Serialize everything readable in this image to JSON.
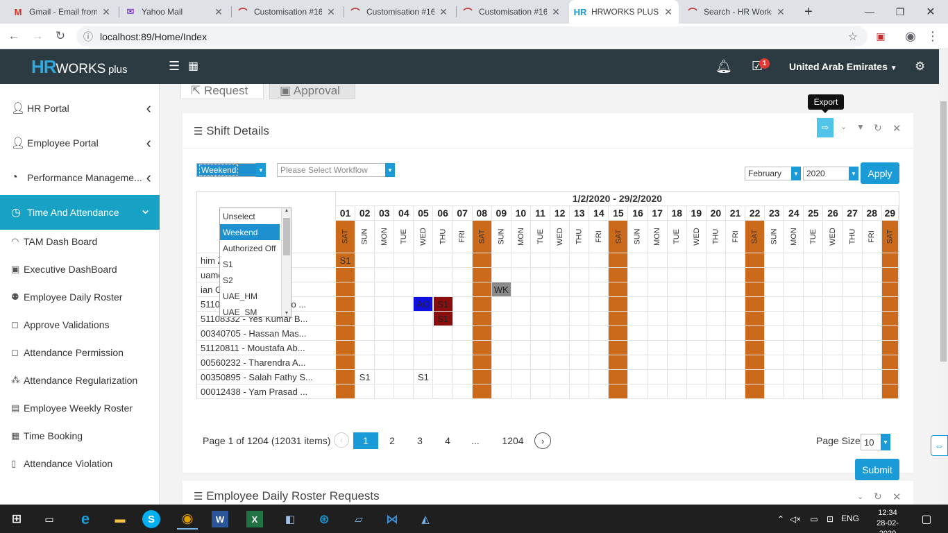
{
  "browser": {
    "tabs": [
      {
        "title": "Gmail - Email from",
        "fav": "M",
        "color": "#d93025"
      },
      {
        "title": "Yahoo Mail",
        "fav": "✉",
        "color": "#6001d2"
      },
      {
        "title": "Customisation #16",
        "fav": "⌒",
        "color": "#c62828"
      },
      {
        "title": "Customisation #16",
        "fav": "⌒",
        "color": "#c62828"
      },
      {
        "title": "Customisation #16",
        "fav": "⌒",
        "color": "#c62828"
      },
      {
        "title": "HRWORKS PLUS |",
        "fav": "HR",
        "color": "#1a9ad6"
      },
      {
        "title": "Search - HR Works",
        "fav": "⌒",
        "color": "#c62828"
      }
    ],
    "url": "localhost:89/Home/Index"
  },
  "header": {
    "logo_hr": "HR",
    "logo_works": "WORKS",
    "logo_plus": "plus",
    "notif_count": "1",
    "country": "United Arab Emirates"
  },
  "sidebar": {
    "items": [
      {
        "label": "HR Portal",
        "icon": "user-icon"
      },
      {
        "label": "Employee Portal",
        "icon": "user-icon"
      },
      {
        "label": "Performance Manageme...",
        "icon": "gauge-icon"
      },
      {
        "label": "Time And Attendance",
        "icon": "clock-icon"
      }
    ],
    "subitems": [
      "TAM Dash Board",
      "Executive DashBoard",
      "Employee Daily Roster",
      "Approve Validations",
      "Attendance Permission",
      "Attendance Regularization",
      "Employee Weekly Roster",
      "Time Booking",
      "Attendance Violation"
    ]
  },
  "main": {
    "top_tabs": [
      "Request",
      "Approval"
    ],
    "card_title": "Shift Details",
    "tooltip": "Export",
    "shift_select": "Weekend",
    "workflow_placeholder": "Please Select  Workflow",
    "month": "February",
    "year": "2020",
    "apply": "Apply",
    "dropdown_options": [
      "Unselect",
      "Weekend",
      "Authorized Off",
      "S1",
      "S2",
      "UAE_HM",
      "UAE_SM"
    ],
    "header_partial": "e",
    "range": "1/2/2020 - 29/2/2020",
    "days": [
      "01",
      "02",
      "03",
      "04",
      "05",
      "06",
      "07",
      "08",
      "09",
      "10",
      "11",
      "12",
      "13",
      "14",
      "15",
      "16",
      "17",
      "18",
      "19",
      "20",
      "21",
      "22",
      "23",
      "24",
      "25",
      "26",
      "27",
      "28",
      "29"
    ],
    "day_names": [
      "SAT",
      "SUN",
      "MON",
      "TUE",
      "WED",
      "THU",
      "FRI",
      "SAT",
      "SUN",
      "MON",
      "TUE",
      "WED",
      "THU",
      "FRI",
      "SAT",
      "SUN",
      "MON",
      "TUE",
      "WED",
      "THU",
      "FRI",
      "SAT",
      "SUN",
      "MON",
      "TUE",
      "WED",
      "THU",
      "FRI",
      "SAT"
    ],
    "employees": [
      "him Zaka...",
      "uamen M...",
      "ian Gurung",
      "51105569 - Jesus Mayo ...",
      "51108332 - Yes Kumar B...",
      "00340705 - Hassan Mas...",
      "51120811 - Moustafa Ab...",
      "00560232 - Tharendra A...",
      "00350895 - Salah Fathy S...",
      "00012438 - Yam Prasad ..."
    ],
    "shifts": [
      {
        "row": 0,
        "day": 0,
        "text": "S1",
        "bg": "#cc6a1c"
      },
      {
        "row": 2,
        "day": 8,
        "text": "WK",
        "bg": "#8a8a8a"
      },
      {
        "row": 3,
        "day": 4,
        "text": "AO",
        "bg": "#1010e0"
      },
      {
        "row": 3,
        "day": 5,
        "text": "S1",
        "bg": "#8b0e0e"
      },
      {
        "row": 4,
        "day": 5,
        "text": "S1",
        "bg": "#8b0e0e"
      },
      {
        "row": 8,
        "day": 1,
        "text": "S1",
        "bg": ""
      },
      {
        "row": 8,
        "day": 4,
        "text": "S1",
        "bg": ""
      }
    ],
    "weekend_color": "#cc6a1c",
    "pager": {
      "info": "Page 1 of 1204 (12031 items)",
      "pages": [
        "1",
        "2",
        "3",
        "4",
        "...",
        "1204"
      ],
      "page_size_label": "Page Size",
      "page_size": "10"
    },
    "submit": "Submit",
    "second_card_title": "Employee Daily Roster Requests"
  },
  "taskbar": {
    "lang": "ENG",
    "time": "12:34",
    "date": "28-02-2020"
  }
}
